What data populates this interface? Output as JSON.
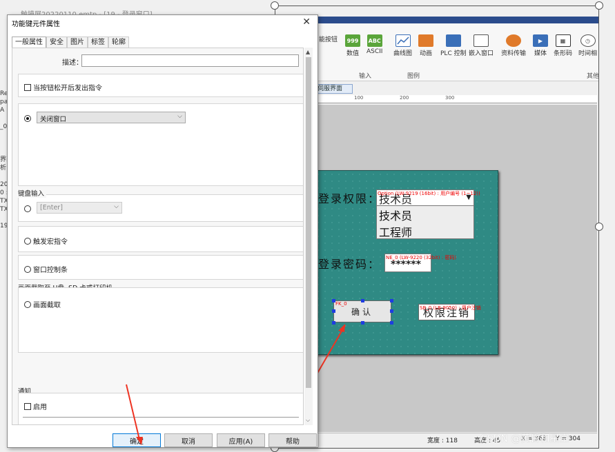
{
  "app": {
    "title": "触摸屏20220110.emtp - [19 - 登录窗口]",
    "ribbon": {
      "items": [
        {
          "label": "能按钮",
          "icon": "function-button-icon"
        },
        {
          "label": "数值",
          "icon": "numeric-icon",
          "text": "999"
        },
        {
          "label": "ASCII",
          "icon": "ascii-icon",
          "text": "ABC"
        },
        {
          "label": "曲线图",
          "icon": "curve-chart-icon"
        },
        {
          "label": "动画",
          "icon": "animation-icon"
        },
        {
          "label": "PLC 控制",
          "icon": "plc-control-icon"
        },
        {
          "label": "嵌入窗口",
          "icon": "embed-window-icon"
        },
        {
          "label": "资料传输",
          "icon": "data-transfer-icon"
        },
        {
          "label": "媒体",
          "icon": "media-icon"
        },
        {
          "label": "条形码",
          "icon": "barcode-icon"
        },
        {
          "label": "时间相",
          "icon": "clock-icon"
        }
      ],
      "groups": {
        "input": "输入",
        "chart": "图例",
        "other": "其他"
      }
    },
    "doc_tab": "伺服界面",
    "ruler_ticks": [
      "100",
      "200",
      "300"
    ],
    "left_strip": "Re\npa\nA\n\n_0\n\n\n\n界面\n析\n\n20\n0 :\nTX\nTX\n\n19"
  },
  "screen": {
    "login_level_label": "登录权限：",
    "login_level_tag": "Option (LW-9219 (16bit) : 用户编号 (1~12))",
    "dropdown_selected": "技术员",
    "dropdown_options": [
      "技术员",
      "工程师"
    ],
    "password_label": "登录密码：",
    "password_tag": "NE_0 (LW-9220 (32bit) : 密码)",
    "password_value": "******",
    "ok_tag": "FK_0",
    "ok_label": "确认",
    "cancel_tag": "SB_0 (LB-9050) : 用户注销",
    "cancel_label": "权限注销"
  },
  "status": {
    "width": "宽度 : 118",
    "height": "高度 : 45",
    "x": "X = 368",
    "y": "Y = 304"
  },
  "watermark": "CSDN @黄昏和星空",
  "dialog": {
    "title": "功能键元件属性",
    "close": "✕",
    "tabs": [
      "一般属性",
      "安全",
      "图片",
      "标签",
      "轮廓"
    ],
    "desc_label": "描述：",
    "desc_value": "",
    "release_checkbox": "当按钮松开后发出指令",
    "close_window_option": "关闭窗口",
    "keyboard_section": "键盘输入",
    "keyboard_value": "[Enter]",
    "macro_option": "触发宏指令",
    "window_control_option": "窗口控制条",
    "capture_section": "画面截取至 U盘, SD 卡或打印机",
    "capture_option": "画面截取",
    "notify_section": "通知",
    "enable_option": "启用",
    "buttons": {
      "ok": "确定",
      "cancel": "取消",
      "apply": "应用(A)",
      "help": "帮助"
    }
  }
}
